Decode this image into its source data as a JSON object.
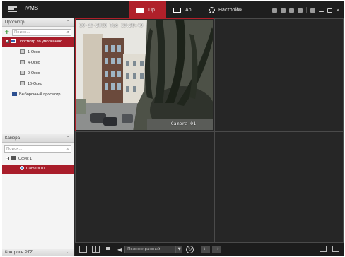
{
  "app": {
    "name": "iVMS"
  },
  "tabs": [
    {
      "label": "Пр...",
      "active": true,
      "icon": "live-view-icon"
    },
    {
      "label": "Ар...",
      "active": false,
      "icon": "playback-icon"
    },
    {
      "label": "Настройки",
      "active": false,
      "icon": "gear-icon"
    }
  ],
  "view_panel": {
    "title": "Просмотр",
    "search_placeholder": "Поиск...",
    "items": [
      {
        "label": "Просмотр по умолчанию",
        "selected": true,
        "icon": "view-icon"
      },
      {
        "label": "1-Окно",
        "icon": "window-layout-icon"
      },
      {
        "label": "4-Окно",
        "icon": "window-layout-icon"
      },
      {
        "label": "9-Окно",
        "icon": "window-layout-icon"
      },
      {
        "label": "16-Окно",
        "icon": "window-layout-icon"
      },
      {
        "label": "Выборочный просмотр",
        "icon": "custom-view-icon"
      }
    ]
  },
  "camera_panel": {
    "title": "Камера",
    "search_placeholder": "Поиск...",
    "group": "Офис 1",
    "cameras": [
      {
        "label": "Camera 01",
        "selected": true
      }
    ]
  },
  "ptz_panel": {
    "title": "Контроль PTZ"
  },
  "video": {
    "timestamp": "10-15-2019 Tue 19:20:43",
    "camera_name": "Camera 01"
  },
  "toolbar": {
    "stream_mode": "Полноэкранный"
  },
  "colors": {
    "accent": "#b0202a",
    "background": "#2a2a2a"
  }
}
